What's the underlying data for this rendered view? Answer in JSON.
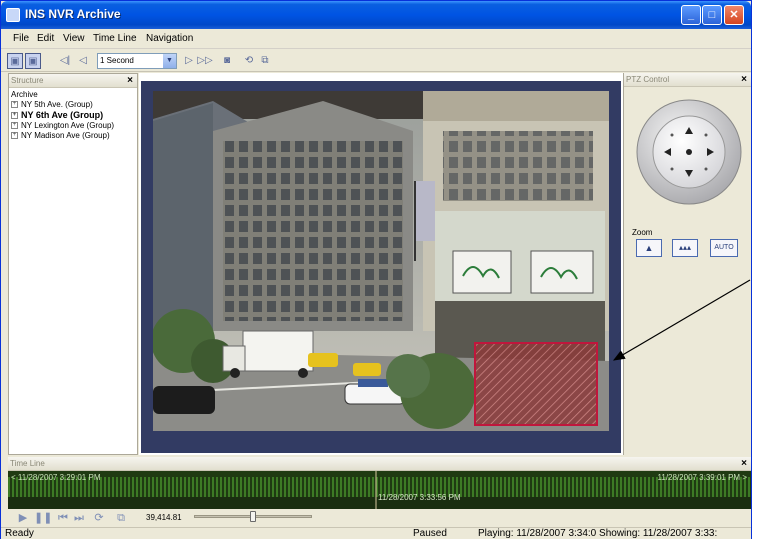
{
  "window": {
    "title": "INS NVR Archive"
  },
  "menu": [
    "File",
    "Edit",
    "View",
    "Time Line",
    "Navigation"
  ],
  "toolbar": {
    "speed_value": "1 Second"
  },
  "structure": {
    "title": "Structure",
    "root": "Archive",
    "items": [
      "NY 5th Ave. (Group)",
      "NY 6th Ave (Group)",
      "NY Lexington Ave (Group)",
      "NY Madison Ave (Group)"
    ]
  },
  "ptz": {
    "title": "PTZ Control",
    "zoom_label": "Zoom",
    "auto_label": "AUTO"
  },
  "timeline": {
    "title": "Time Line",
    "start_time": "< 11/28/2007 3:29:01 PM",
    "end_time": "11/28/2007 3:39:01 PM >",
    "cursor_time": "11/28/2007 3:33:56 PM",
    "position_value": "39,414.81",
    "slider_level": 0.5
  },
  "status": {
    "left": "Ready",
    "state": "Paused",
    "playing": "Playing: 11/28/2007 3:34:0 Showing: 11/28/2007 3:33:"
  },
  "colors": {
    "title_bar": "#0054e3",
    "video_frame": "#323b63",
    "timeline_bg": "#1f3a12",
    "highlight": "#c0163c"
  }
}
